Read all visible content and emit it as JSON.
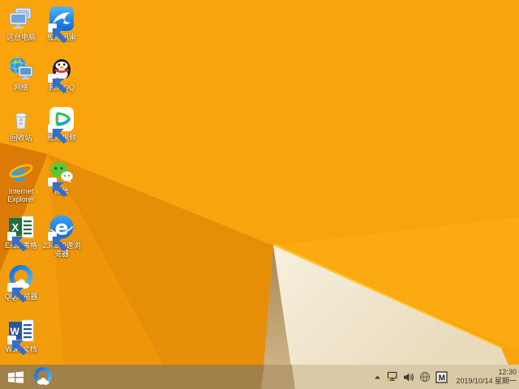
{
  "wallpaper": {
    "base": "#F9A40C",
    "band_above_wedge": "#FBAA11",
    "left_dark_facet": "#DB7B06",
    "mid_facet": "#E78E09",
    "mid_facet_2": "#EE9509",
    "lower_left_facet": "#F39D0D",
    "tan_strip": "#C2A169",
    "edge_highlight": "#FFC433",
    "cream_top": "#F8F0DE",
    "cream_bottom": "#E8DBBC"
  },
  "desktop": {
    "icons": [
      {
        "name": "this-pc",
        "label": "这台电脑"
      },
      {
        "name": "thunder-speed",
        "label": "极速迅雷"
      },
      {
        "name": "network",
        "label": "网络"
      },
      {
        "name": "tencent-qq",
        "label": "腾讯QQ"
      },
      {
        "name": "recycle-bin",
        "label": "回收站"
      },
      {
        "name": "tencent-video",
        "label": "腾讯视频"
      },
      {
        "name": "internet-explorer",
        "label_line1": "Internet",
        "label_line2": "Explorer"
      },
      {
        "name": "wechat",
        "label": "微信"
      },
      {
        "name": "excel",
        "label": "Excel表格"
      },
      {
        "name": "browser-2345",
        "label_line1": "2345加速浏",
        "label_line2": "览器"
      },
      {
        "name": "qq-browser",
        "label": "QQ浏览器"
      },
      {
        "name": "word",
        "label": "Word文档"
      }
    ]
  },
  "taskbar": {
    "colors": {
      "left": "#A28049",
      "middle": "#B49A6C",
      "right": "#D9C9A6"
    },
    "pinned_icons": [
      "windows-start",
      "qq-browser"
    ],
    "tray": {
      "icons": [
        "hidden-icons-chevron",
        "network-status-warning",
        "volume",
        "input-sphere",
        "ime-mode-badge"
      ],
      "ime_badge": "M"
    },
    "clock": {
      "time": "12:30",
      "date": "2019/10/14 星期一"
    }
  }
}
